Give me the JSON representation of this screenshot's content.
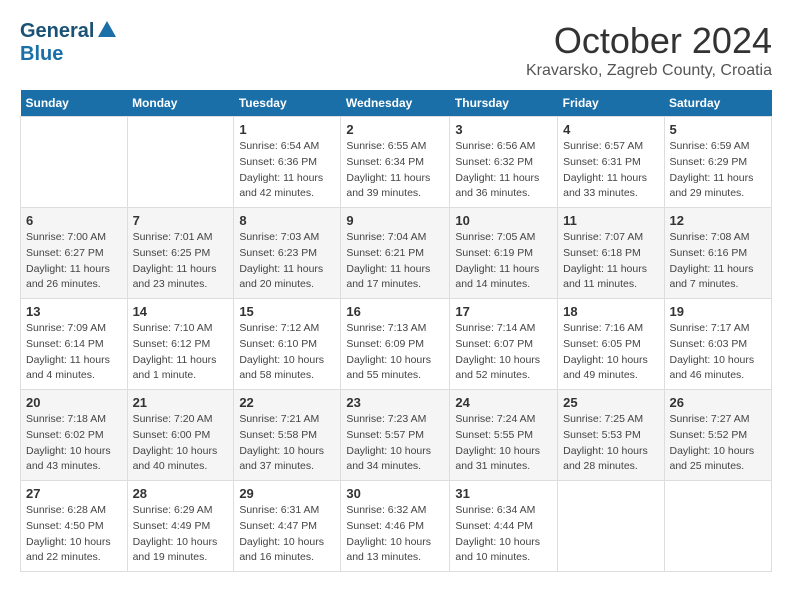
{
  "header": {
    "logo": {
      "line1": "General",
      "line2": "Blue"
    },
    "title": "October 2024",
    "subtitle": "Kravarsko, Zagreb County, Croatia"
  },
  "weekdays": [
    "Sunday",
    "Monday",
    "Tuesday",
    "Wednesday",
    "Thursday",
    "Friday",
    "Saturday"
  ],
  "weeks": [
    [
      {
        "day": "",
        "sunrise": "",
        "sunset": "",
        "daylight": ""
      },
      {
        "day": "",
        "sunrise": "",
        "sunset": "",
        "daylight": ""
      },
      {
        "day": "1",
        "sunrise": "Sunrise: 6:54 AM",
        "sunset": "Sunset: 6:36 PM",
        "daylight": "Daylight: 11 hours and 42 minutes."
      },
      {
        "day": "2",
        "sunrise": "Sunrise: 6:55 AM",
        "sunset": "Sunset: 6:34 PM",
        "daylight": "Daylight: 11 hours and 39 minutes."
      },
      {
        "day": "3",
        "sunrise": "Sunrise: 6:56 AM",
        "sunset": "Sunset: 6:32 PM",
        "daylight": "Daylight: 11 hours and 36 minutes."
      },
      {
        "day": "4",
        "sunrise": "Sunrise: 6:57 AM",
        "sunset": "Sunset: 6:31 PM",
        "daylight": "Daylight: 11 hours and 33 minutes."
      },
      {
        "day": "5",
        "sunrise": "Sunrise: 6:59 AM",
        "sunset": "Sunset: 6:29 PM",
        "daylight": "Daylight: 11 hours and 29 minutes."
      }
    ],
    [
      {
        "day": "6",
        "sunrise": "Sunrise: 7:00 AM",
        "sunset": "Sunset: 6:27 PM",
        "daylight": "Daylight: 11 hours and 26 minutes."
      },
      {
        "day": "7",
        "sunrise": "Sunrise: 7:01 AM",
        "sunset": "Sunset: 6:25 PM",
        "daylight": "Daylight: 11 hours and 23 minutes."
      },
      {
        "day": "8",
        "sunrise": "Sunrise: 7:03 AM",
        "sunset": "Sunset: 6:23 PM",
        "daylight": "Daylight: 11 hours and 20 minutes."
      },
      {
        "day": "9",
        "sunrise": "Sunrise: 7:04 AM",
        "sunset": "Sunset: 6:21 PM",
        "daylight": "Daylight: 11 hours and 17 minutes."
      },
      {
        "day": "10",
        "sunrise": "Sunrise: 7:05 AM",
        "sunset": "Sunset: 6:19 PM",
        "daylight": "Daylight: 11 hours and 14 minutes."
      },
      {
        "day": "11",
        "sunrise": "Sunrise: 7:07 AM",
        "sunset": "Sunset: 6:18 PM",
        "daylight": "Daylight: 11 hours and 11 minutes."
      },
      {
        "day": "12",
        "sunrise": "Sunrise: 7:08 AM",
        "sunset": "Sunset: 6:16 PM",
        "daylight": "Daylight: 11 hours and 7 minutes."
      }
    ],
    [
      {
        "day": "13",
        "sunrise": "Sunrise: 7:09 AM",
        "sunset": "Sunset: 6:14 PM",
        "daylight": "Daylight: 11 hours and 4 minutes."
      },
      {
        "day": "14",
        "sunrise": "Sunrise: 7:10 AM",
        "sunset": "Sunset: 6:12 PM",
        "daylight": "Daylight: 11 hours and 1 minute."
      },
      {
        "day": "15",
        "sunrise": "Sunrise: 7:12 AM",
        "sunset": "Sunset: 6:10 PM",
        "daylight": "Daylight: 10 hours and 58 minutes."
      },
      {
        "day": "16",
        "sunrise": "Sunrise: 7:13 AM",
        "sunset": "Sunset: 6:09 PM",
        "daylight": "Daylight: 10 hours and 55 minutes."
      },
      {
        "day": "17",
        "sunrise": "Sunrise: 7:14 AM",
        "sunset": "Sunset: 6:07 PM",
        "daylight": "Daylight: 10 hours and 52 minutes."
      },
      {
        "day": "18",
        "sunrise": "Sunrise: 7:16 AM",
        "sunset": "Sunset: 6:05 PM",
        "daylight": "Daylight: 10 hours and 49 minutes."
      },
      {
        "day": "19",
        "sunrise": "Sunrise: 7:17 AM",
        "sunset": "Sunset: 6:03 PM",
        "daylight": "Daylight: 10 hours and 46 minutes."
      }
    ],
    [
      {
        "day": "20",
        "sunrise": "Sunrise: 7:18 AM",
        "sunset": "Sunset: 6:02 PM",
        "daylight": "Daylight: 10 hours and 43 minutes."
      },
      {
        "day": "21",
        "sunrise": "Sunrise: 7:20 AM",
        "sunset": "Sunset: 6:00 PM",
        "daylight": "Daylight: 10 hours and 40 minutes."
      },
      {
        "day": "22",
        "sunrise": "Sunrise: 7:21 AM",
        "sunset": "Sunset: 5:58 PM",
        "daylight": "Daylight: 10 hours and 37 minutes."
      },
      {
        "day": "23",
        "sunrise": "Sunrise: 7:23 AM",
        "sunset": "Sunset: 5:57 PM",
        "daylight": "Daylight: 10 hours and 34 minutes."
      },
      {
        "day": "24",
        "sunrise": "Sunrise: 7:24 AM",
        "sunset": "Sunset: 5:55 PM",
        "daylight": "Daylight: 10 hours and 31 minutes."
      },
      {
        "day": "25",
        "sunrise": "Sunrise: 7:25 AM",
        "sunset": "Sunset: 5:53 PM",
        "daylight": "Daylight: 10 hours and 28 minutes."
      },
      {
        "day": "26",
        "sunrise": "Sunrise: 7:27 AM",
        "sunset": "Sunset: 5:52 PM",
        "daylight": "Daylight: 10 hours and 25 minutes."
      }
    ],
    [
      {
        "day": "27",
        "sunrise": "Sunrise: 6:28 AM",
        "sunset": "Sunset: 4:50 PM",
        "daylight": "Daylight: 10 hours and 22 minutes."
      },
      {
        "day": "28",
        "sunrise": "Sunrise: 6:29 AM",
        "sunset": "Sunset: 4:49 PM",
        "daylight": "Daylight: 10 hours and 19 minutes."
      },
      {
        "day": "29",
        "sunrise": "Sunrise: 6:31 AM",
        "sunset": "Sunset: 4:47 PM",
        "daylight": "Daylight: 10 hours and 16 minutes."
      },
      {
        "day": "30",
        "sunrise": "Sunrise: 6:32 AM",
        "sunset": "Sunset: 4:46 PM",
        "daylight": "Daylight: 10 hours and 13 minutes."
      },
      {
        "day": "31",
        "sunrise": "Sunrise: 6:34 AM",
        "sunset": "Sunset: 4:44 PM",
        "daylight": "Daylight: 10 hours and 10 minutes."
      },
      {
        "day": "",
        "sunrise": "",
        "sunset": "",
        "daylight": ""
      },
      {
        "day": "",
        "sunrise": "",
        "sunset": "",
        "daylight": ""
      }
    ]
  ]
}
